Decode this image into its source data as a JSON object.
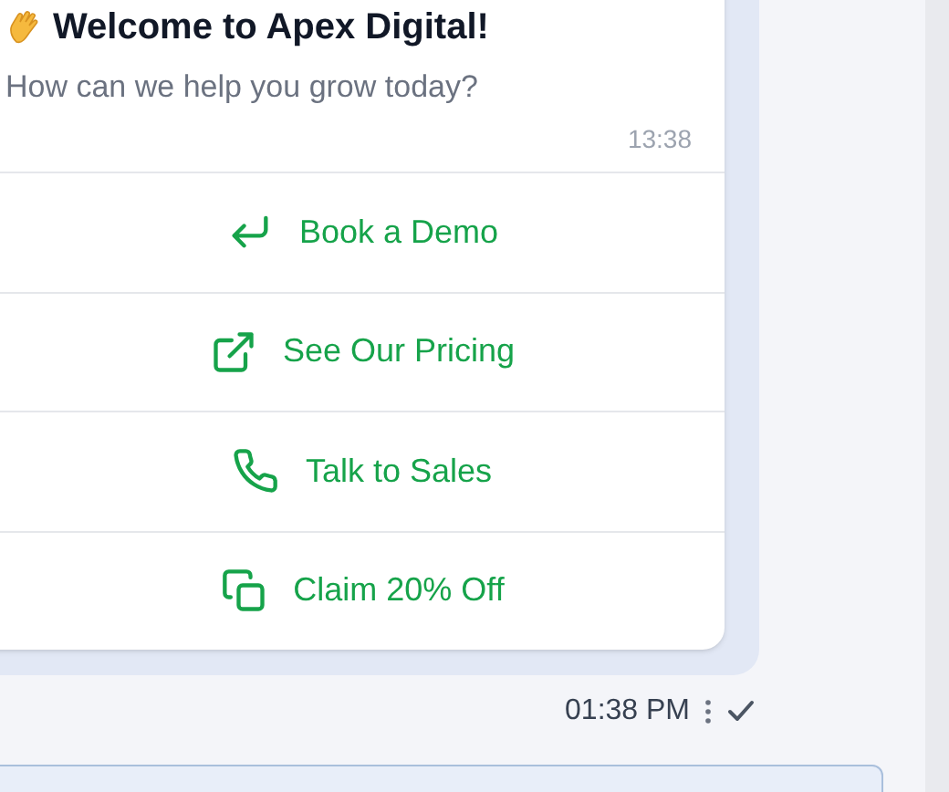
{
  "message": {
    "title": "Welcome to Apex Digital!",
    "subtitle": "How can we help you grow today?",
    "time": "13:38",
    "actions": [
      {
        "kind": "return",
        "label": "Book a Demo"
      },
      {
        "kind": "external",
        "label": "See Our Pricing"
      },
      {
        "kind": "phone",
        "label": "Talk to Sales"
      },
      {
        "kind": "copy",
        "label": "Claim 20% Off"
      }
    ]
  },
  "footer": {
    "time": "01:38 PM",
    "delivered": true
  }
}
